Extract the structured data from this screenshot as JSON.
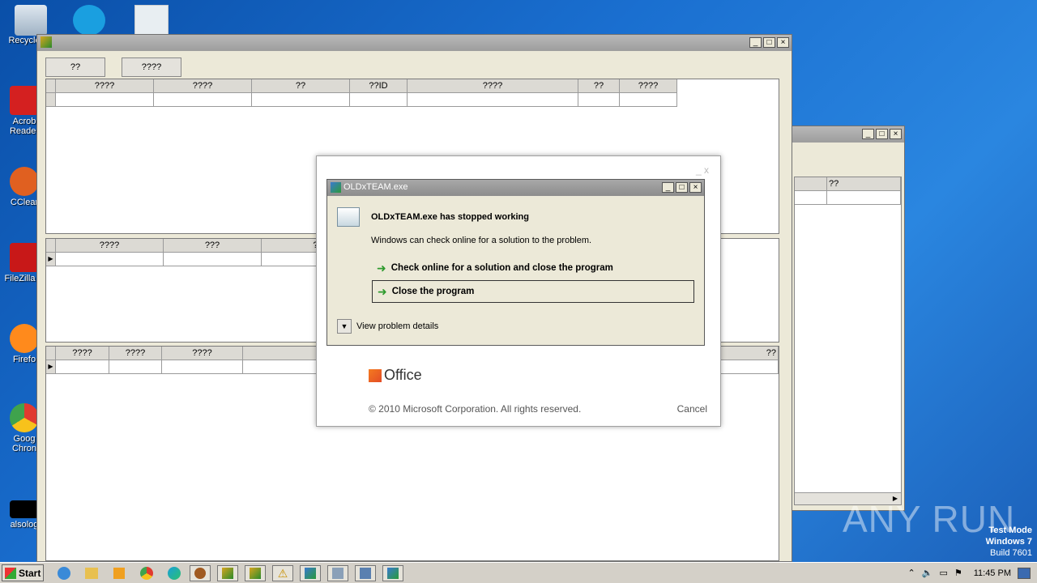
{
  "desktop": {
    "icons": [
      {
        "label": "Recycle",
        "icon": "recycle-bin-icon",
        "color": "#c8d4e0"
      },
      {
        "label": "Acrob Reader",
        "icon": "acrobat-reader-icon",
        "color": "#d42020"
      },
      {
        "label": "CClear",
        "icon": "ccleaner-icon",
        "color": "#e06020"
      },
      {
        "label": "FileZilla C",
        "icon": "filezilla-icon",
        "color": "#c81818"
      },
      {
        "label": "Firefo",
        "icon": "firefox-icon",
        "color": "#ff8a1c"
      },
      {
        "label": "Goog Chron",
        "icon": "chrome-icon",
        "color": "#3fa34d"
      },
      {
        "label": "alsolog",
        "icon": "shortcut-icon",
        "color": "#000000"
      }
    ]
  },
  "main_window": {
    "title": "",
    "buttons": [
      "??",
      "????"
    ],
    "grid1": {
      "headers": [
        "????",
        "????",
        "??",
        "??ID",
        "????",
        "??",
        "????"
      ]
    },
    "grid2": {
      "headers": [
        "????",
        "???",
        "??"
      ]
    },
    "grid3": {
      "headers": [
        "????",
        "????",
        "????"
      ],
      "trailing_header": "??"
    }
  },
  "second_window": {
    "header": "??"
  },
  "office_dialog": {
    "minimize": "_",
    "close": "x",
    "logo_text": "Office",
    "copyright": "© 2010 Microsoft Corporation.  All rights reserved.",
    "cancel": "Cancel"
  },
  "error_dialog": {
    "title": "OLDxTEAM.exe",
    "heading": "OLDxTEAM.exe has stopped working",
    "subtext": "Windows can check online for a solution to the problem.",
    "option1": "Check online for a solution and close the program",
    "option2": "Close the program",
    "details": "View problem details"
  },
  "taskbar": {
    "start": "Start",
    "clock": "11:45 PM"
  },
  "watermark": "ANY RUN",
  "test_mode": {
    "line1": "Test Mode",
    "line2": "Windows 7",
    "line3": "Build 7601"
  }
}
